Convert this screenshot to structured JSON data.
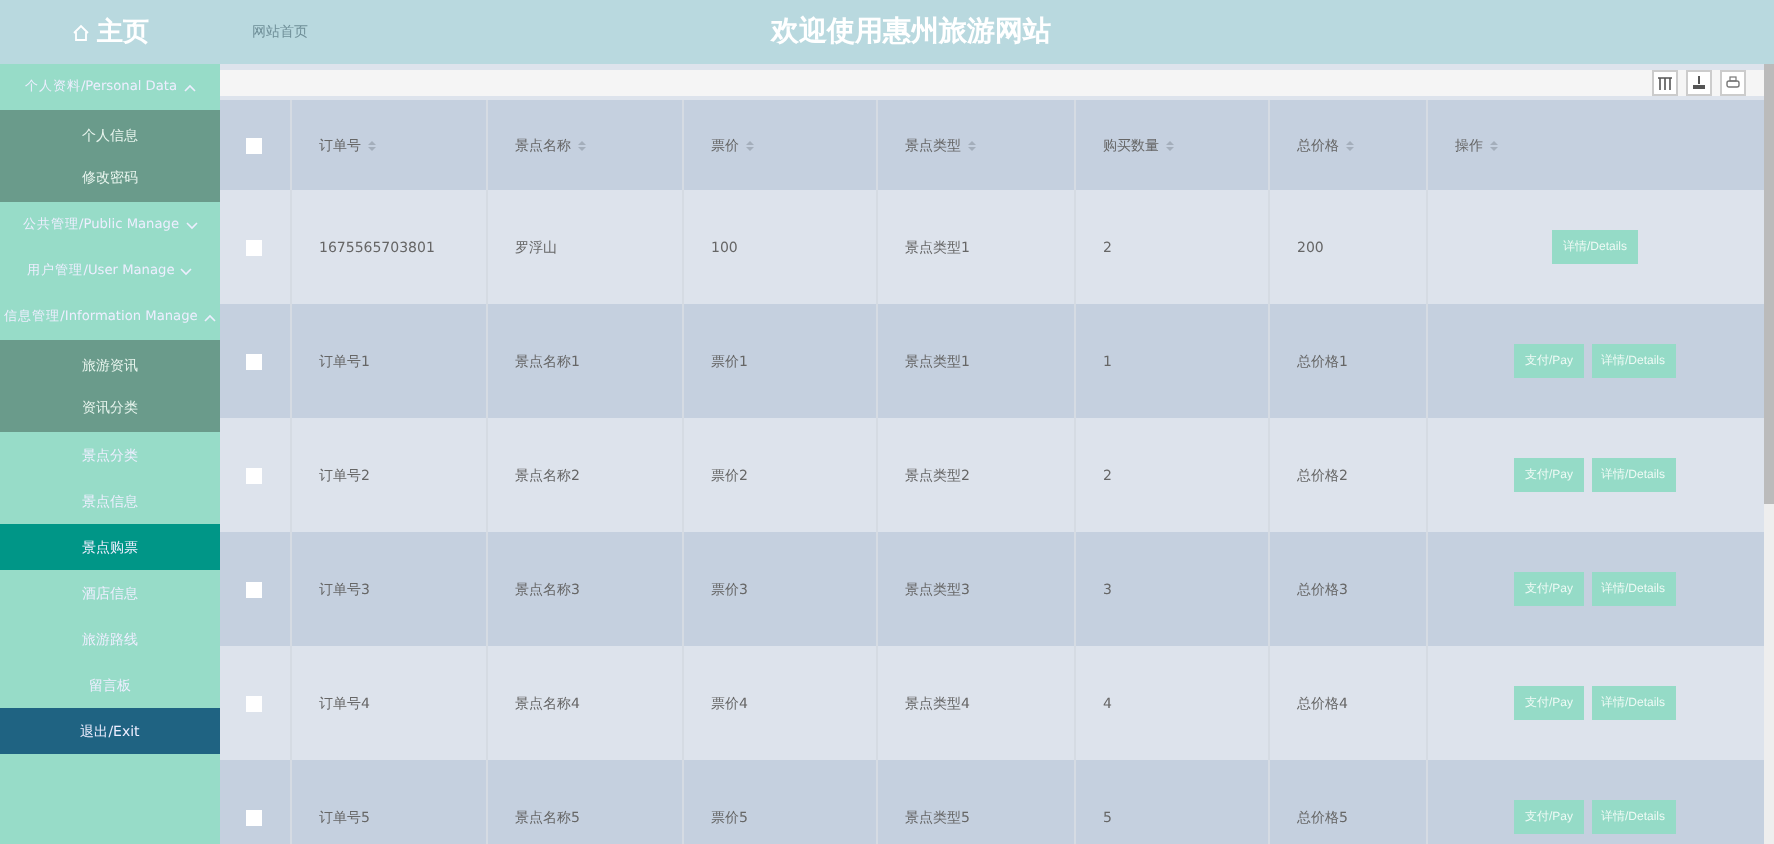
{
  "header": {
    "home": "主页",
    "breadcrumb": "网站首页",
    "title": "欢迎使用惠州旅游网站"
  },
  "sidebar": [
    {
      "kind": "group",
      "label": "个人资料/Personal Data",
      "expanded": true,
      "children": [
        {
          "label": "个人信息",
          "selected": false
        },
        {
          "label": "修改密码",
          "selected": false
        }
      ]
    },
    {
      "kind": "group",
      "label": "公共管理/Public Manage",
      "expanded": false
    },
    {
      "kind": "group",
      "label": "用户管理/User Manage",
      "expanded": false
    },
    {
      "kind": "group",
      "label": "信息管理/Information Manage",
      "expanded": true,
      "children": [
        {
          "label": "旅游资讯",
          "selected": false
        },
        {
          "label": "资讯分类",
          "selected": false
        }
      ]
    },
    {
      "kind": "item",
      "label": "景点分类",
      "selected": false
    },
    {
      "kind": "item",
      "label": "景点信息",
      "selected": false
    },
    {
      "kind": "item",
      "label": "景点购票",
      "selected": true
    },
    {
      "kind": "item",
      "label": "酒店信息",
      "selected": false
    },
    {
      "kind": "item",
      "label": "旅游路线",
      "selected": false
    },
    {
      "kind": "item",
      "label": "留言板",
      "selected": false
    },
    {
      "kind": "exit",
      "label": "退出/Exit",
      "selected": false
    }
  ],
  "table": {
    "select_all_checked": false,
    "columns": [
      "订单号",
      "景点名称",
      "票价",
      "景点类型",
      "购买数量",
      "总价格",
      "操作"
    ],
    "rows": [
      {
        "checked": false,
        "cells": [
          "1675565703801",
          "罗浮山",
          "100",
          "景点类型1",
          "2",
          "200"
        ],
        "actions": [
          "详情/Details"
        ]
      },
      {
        "checked": false,
        "cells": [
          "订单号1",
          "景点名称1",
          "票价1",
          "景点类型1",
          "1",
          "总价格1"
        ],
        "actions": [
          "支付/Pay",
          "详情/Details"
        ]
      },
      {
        "checked": false,
        "cells": [
          "订单号2",
          "景点名称2",
          "票价2",
          "景点类型2",
          "2",
          "总价格2"
        ],
        "actions": [
          "支付/Pay",
          "详情/Details"
        ]
      },
      {
        "checked": false,
        "cells": [
          "订单号3",
          "景点名称3",
          "票价3",
          "景点类型3",
          "3",
          "总价格3"
        ],
        "actions": [
          "支付/Pay",
          "详情/Details"
        ]
      },
      {
        "checked": false,
        "cells": [
          "订单号4",
          "景点名称4",
          "票价4",
          "景点类型4",
          "4",
          "总价格4"
        ],
        "actions": [
          "支付/Pay",
          "详情/Details"
        ]
      },
      {
        "checked": false,
        "cells": [
          "订单号5",
          "景点名称5",
          "票价5",
          "景点类型5",
          "5",
          "总价格5"
        ],
        "actions": [
          "支付/Pay",
          "详情/Details"
        ]
      }
    ]
  }
}
